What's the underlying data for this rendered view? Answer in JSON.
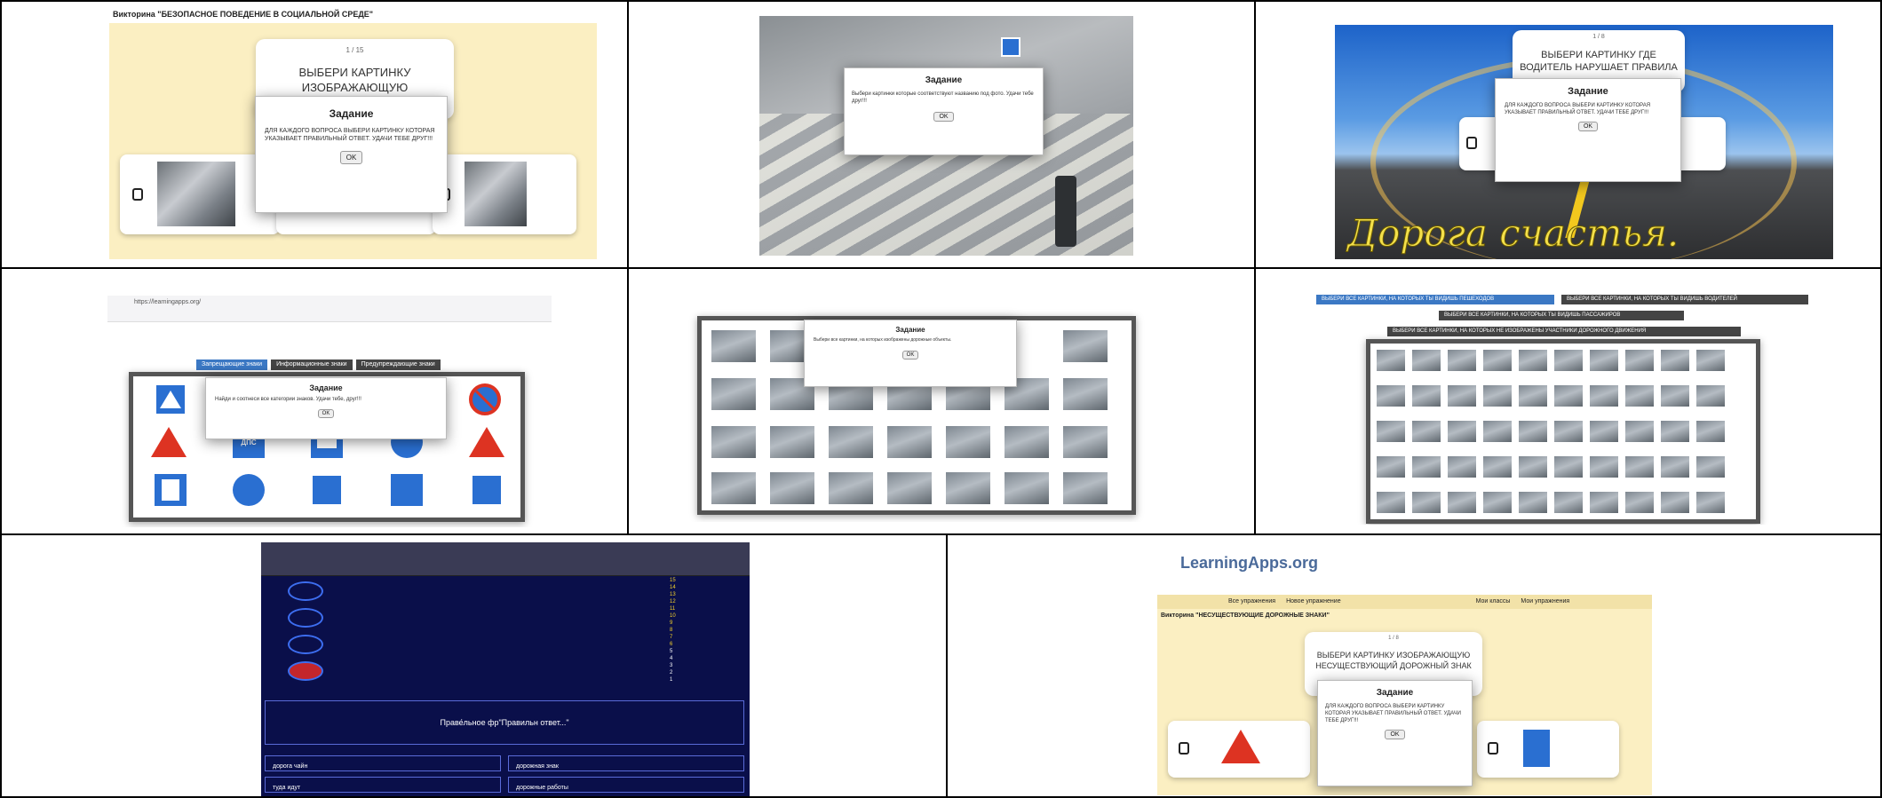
{
  "panels": {
    "p1": {
      "quiz_title": "Викторина \"БЕЗОПАСНОЕ ПОВЕДЕНИЕ В СОЦИАЛЬНОЙ СРЕДЕ\"",
      "counter": "1 / 15",
      "question": "ВЫБЕРИ КАРТИНКУ ИЗОБРАЖАЮЩУЮ БЕЗОПАСНОЕ",
      "dialog_title": "Задание",
      "dialog_text": "ДЛЯ КАЖДОГО ВОПРОСА ВЫБЕРИ КАРТИНКУ КОТОРАЯ УКАЗЫВАЕТ ПРАВИЛЬНЫЙ ОТВЕТ. УДАЧИ ТЕБЕ ДРУГ!!!",
      "ok": "OK"
    },
    "p2": {
      "dialog_title": "Задание",
      "dialog_text": "Выбери картинки которые соответствуют названию под фото. Удачи тебе друг!!!",
      "ok": "OK"
    },
    "p3": {
      "counter": "1 / 8",
      "question": "ВЫБЕРИ КАРТИНКУ ГДЕ ВОДИТЕЛЬ НАРУШАЕТ ПРАВИЛА",
      "dialog_title": "Задание",
      "dialog_text": "ДЛЯ КАЖДОГО ВОПРОСА ВЫБЕРИ КАРТИНКУ КОТОРАЯ УКАЗЫВАЕТ ПРАВИЛЬНЫЙ ОТВЕТ. УДАЧИ ТЕБЕ ДРУГ!!!",
      "ok": "OK",
      "banner": "Дорога счастья."
    },
    "p4": {
      "url": "https://learningapps.org/",
      "tabs": [
        "Запрещающие знаки",
        "Информационные знаки",
        "Предупреждающие знаки"
      ],
      "dialog_title": "Задание",
      "dialog_text": "Найди и соотнеси все категории знаков. Удачи тебе, друг!!!",
      "ok": "OK",
      "sign_text": "ДПС"
    },
    "p5": {
      "dialog_title": "Задание",
      "dialog_text": "Выбери все картинки, на которых изображены дорожные объекты.",
      "ok": "OK"
    },
    "p6": {
      "tags": [
        "ВЫБЕРИ ВСЕ КАРТИНКИ, НА КОТОРЫХ ТЫ ВИДИШЬ ПЕШЕХОДОВ",
        "ВЫБЕРИ ВСЕ КАРТИНКИ, НА КОТОРЫХ ТЫ ВИДИШЬ ВОДИТЕЛЕЙ",
        "ВЫБЕРИ ВСЕ КАРТИНКИ, НА КОТОРЫХ ТЫ ВИДИШЬ ПАССАЖИРОВ",
        "ВЫБЕРИ ВСЕ КАРТИНКИ, НА КОТОРЫХ НЕ ИЗОБРАЖЕНЫ УЧАСТНИКИ ДОРОЖНОГО ДВИЖЕНИЯ"
      ]
    },
    "p7": {
      "prize_list": [
        "15",
        "14",
        "13",
        "12",
        "11",
        "10",
        "9",
        "8",
        "7",
        "6",
        "5",
        "4",
        "3",
        "2",
        "1"
      ],
      "question": "Праве́льное фр\"Правильн ответ...\"",
      "answers": [
        "дорога чайн",
        "дорожная знак",
        "туда идут",
        "дорожные работы"
      ]
    },
    "p8": {
      "brand": "LearningApps.org",
      "menu": [
        "Все упражнения",
        "Новое упражнение",
        "Мои классы",
        "Мои упражнения"
      ],
      "quiz_title": "Викторина \"НЕСУЩЕСТВУЮЩИЕ ДОРОЖНЫЕ ЗНАКИ\"",
      "counter": "1 / 8",
      "question": "ВЫБЕРИ КАРТИНКУ ИЗОБРАЖАЮЩУЮ НЕСУЩЕСТВУЮЩИЙ ДОРОЖНЫЙ ЗНАК",
      "dialog_title": "Задание",
      "dialog_text": "ДЛЯ КАЖДОГО ВОПРОСА ВЫБЕРИ КАРТИНКУ КОТОРАЯ УКАЗЫВАЕТ ПРАВИЛЬНЫЙ ОТВЕТ. УДАЧИ ТЕБЕ ДРУГ!!!",
      "ok": "OK"
    }
  },
  "colors": {
    "quiz_bg": "#fbefc2",
    "tab_blue": "#3b78c4",
    "tab_dark": "#444444",
    "millionaire_bg": "#0a0f4a"
  }
}
